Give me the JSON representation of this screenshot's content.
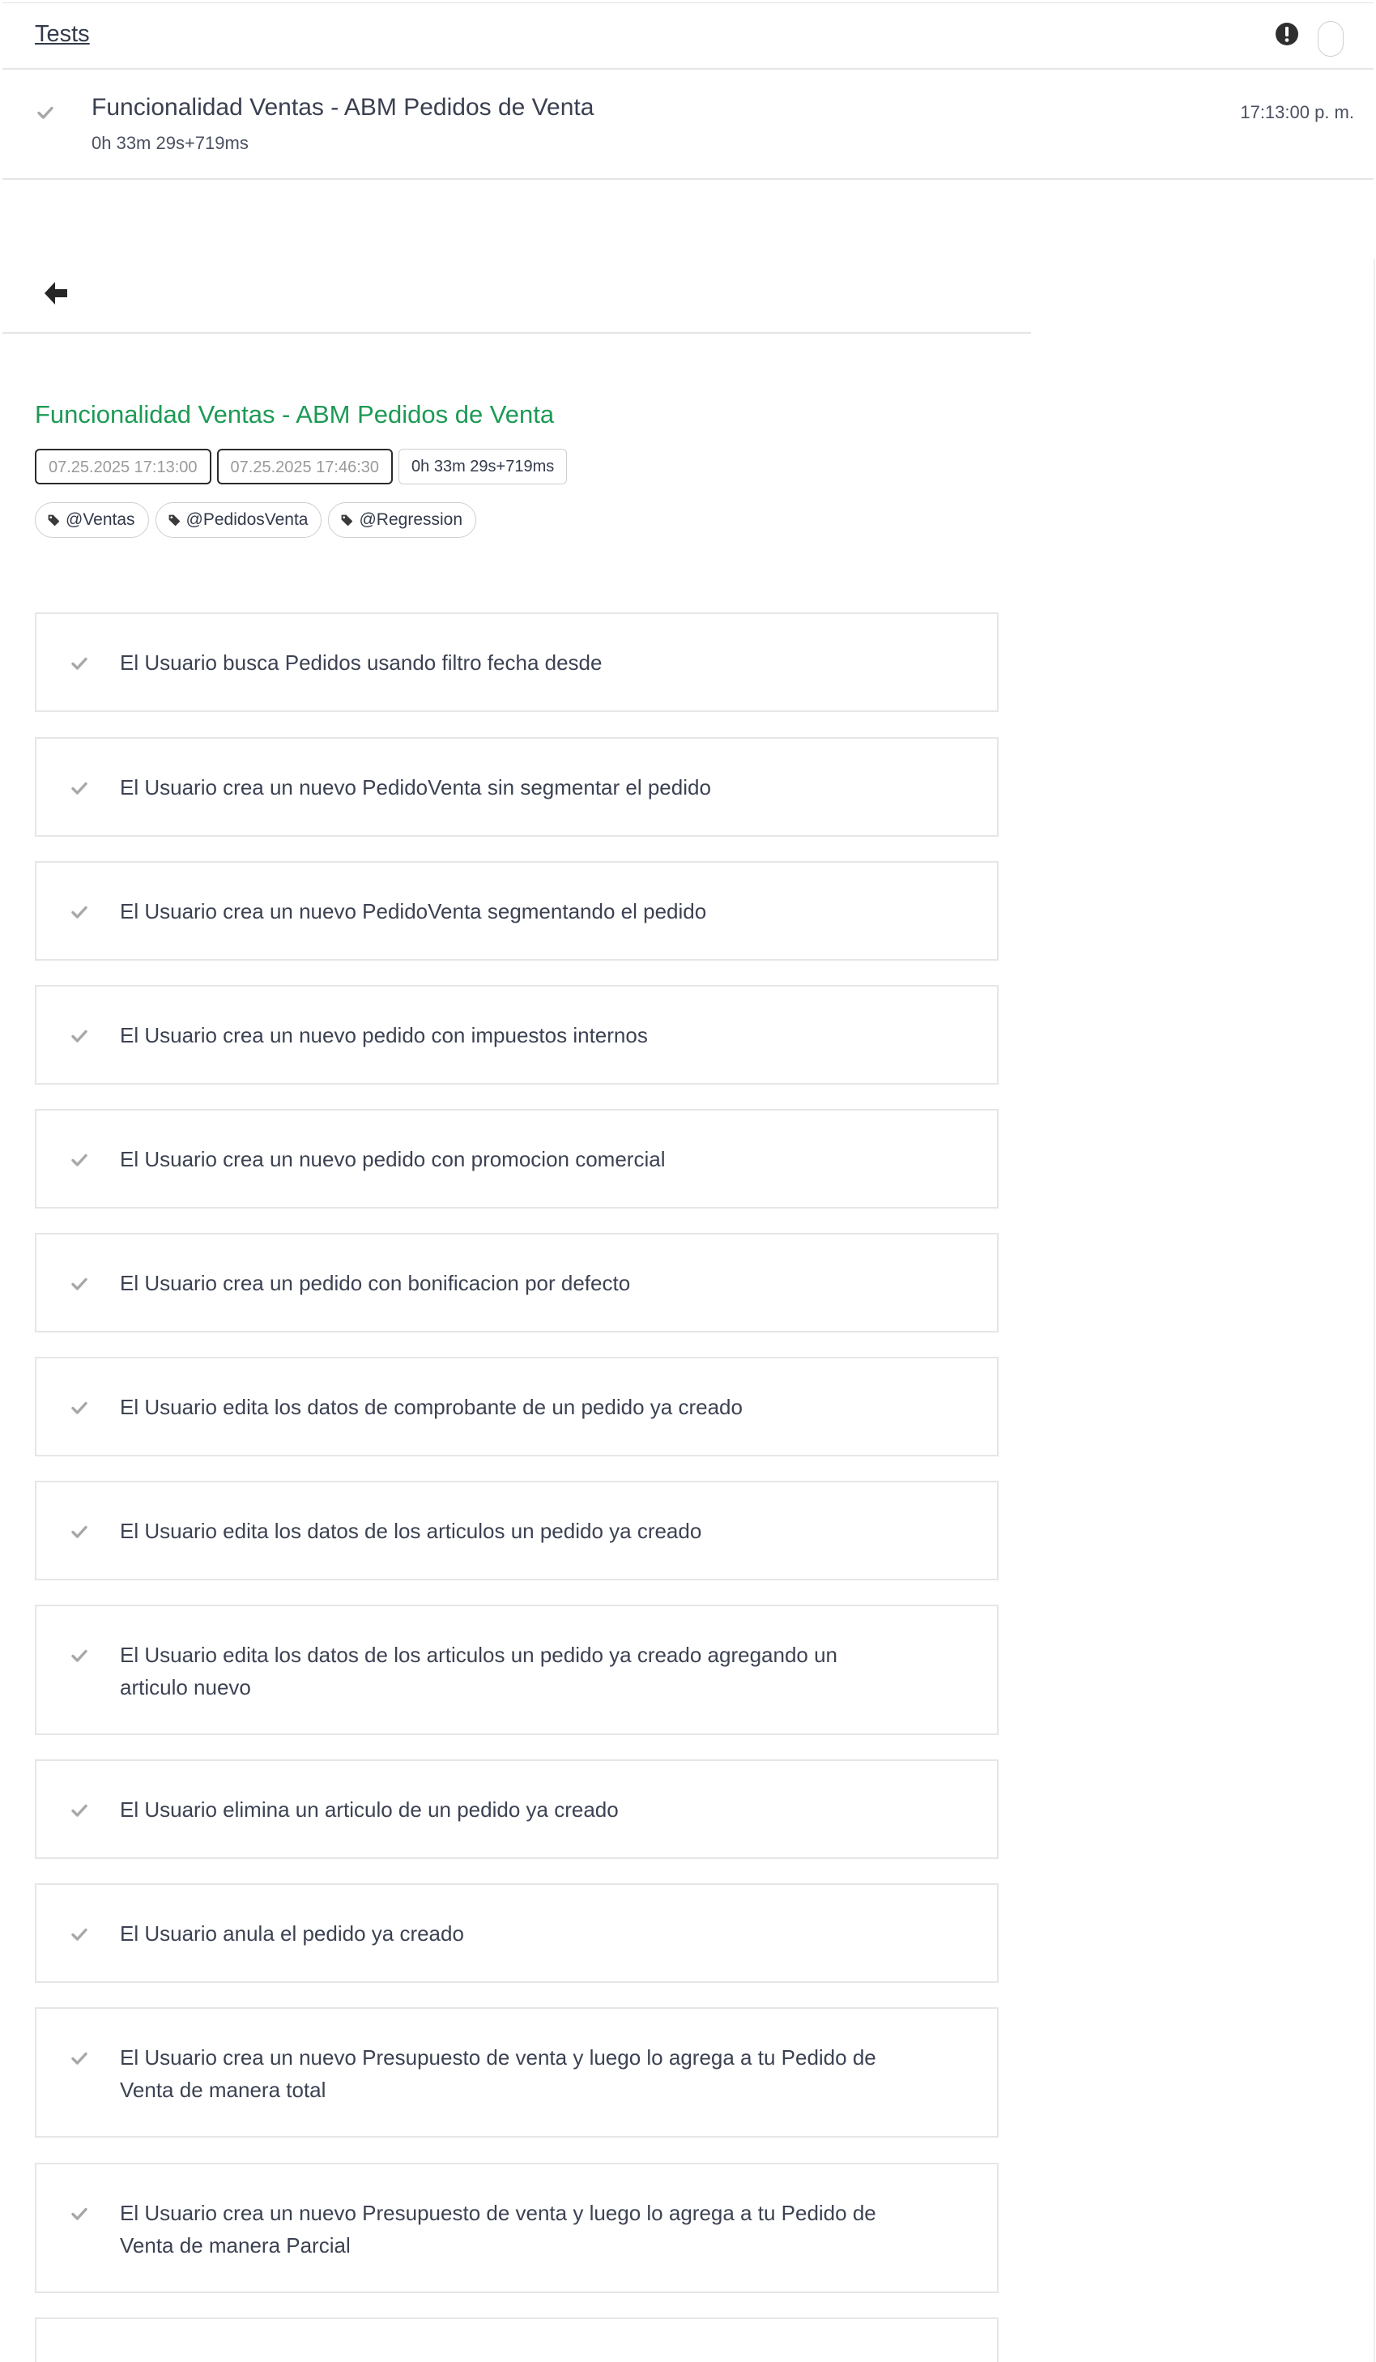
{
  "header": {
    "title": "Tests"
  },
  "test": {
    "name": "Funcionalidad Ventas - ABM Pedidos de Venta",
    "duration": "0h 33m 29s+719ms",
    "time": "17:13:00 p. m."
  },
  "detail": {
    "title": "Funcionalidad Ventas - ABM Pedidos de Venta",
    "start": "07.25.2025 17:13:00",
    "end": "07.25.2025 17:46:30",
    "duration": "0h 33m 29s+719ms",
    "tags": [
      "@Ventas",
      "@PedidosVenta",
      "@Regression"
    ]
  },
  "steps": [
    "El Usuario busca Pedidos usando filtro fecha desde",
    "El Usuario crea un nuevo PedidoVenta sin segmentar el pedido",
    "El Usuario crea un nuevo PedidoVenta segmentando el pedido",
    "El Usuario crea un nuevo pedido con impuestos internos",
    "El Usuario crea un nuevo pedido con promocion comercial",
    "El Usuario crea un pedido con bonificacion por defecto",
    "El Usuario edita los datos de comprobante de un pedido ya creado",
    "El Usuario edita los datos de los articulos un pedido ya creado",
    "El Usuario edita los datos de los articulos un pedido ya creado agregando un articulo nuevo",
    "El Usuario elimina un articulo de un pedido ya creado",
    "El Usuario anula el pedido ya creado",
    "El Usuario crea un nuevo Presupuesto de venta y luego lo agrega a tu Pedido de Venta de manera total",
    "El Usuario crea un nuevo Presupuesto de venta y luego lo agrega a tu Pedido de Venta de manera Parcial",
    ""
  ],
  "icons": {
    "alert": "exclamation-circle-icon",
    "tag": "tag-icon",
    "back": "arrow-left-icon",
    "status": "check-icon"
  },
  "colors": {
    "pass_title": "#1c9a55",
    "check": "#a8a8a8",
    "text": "#333a4a"
  }
}
